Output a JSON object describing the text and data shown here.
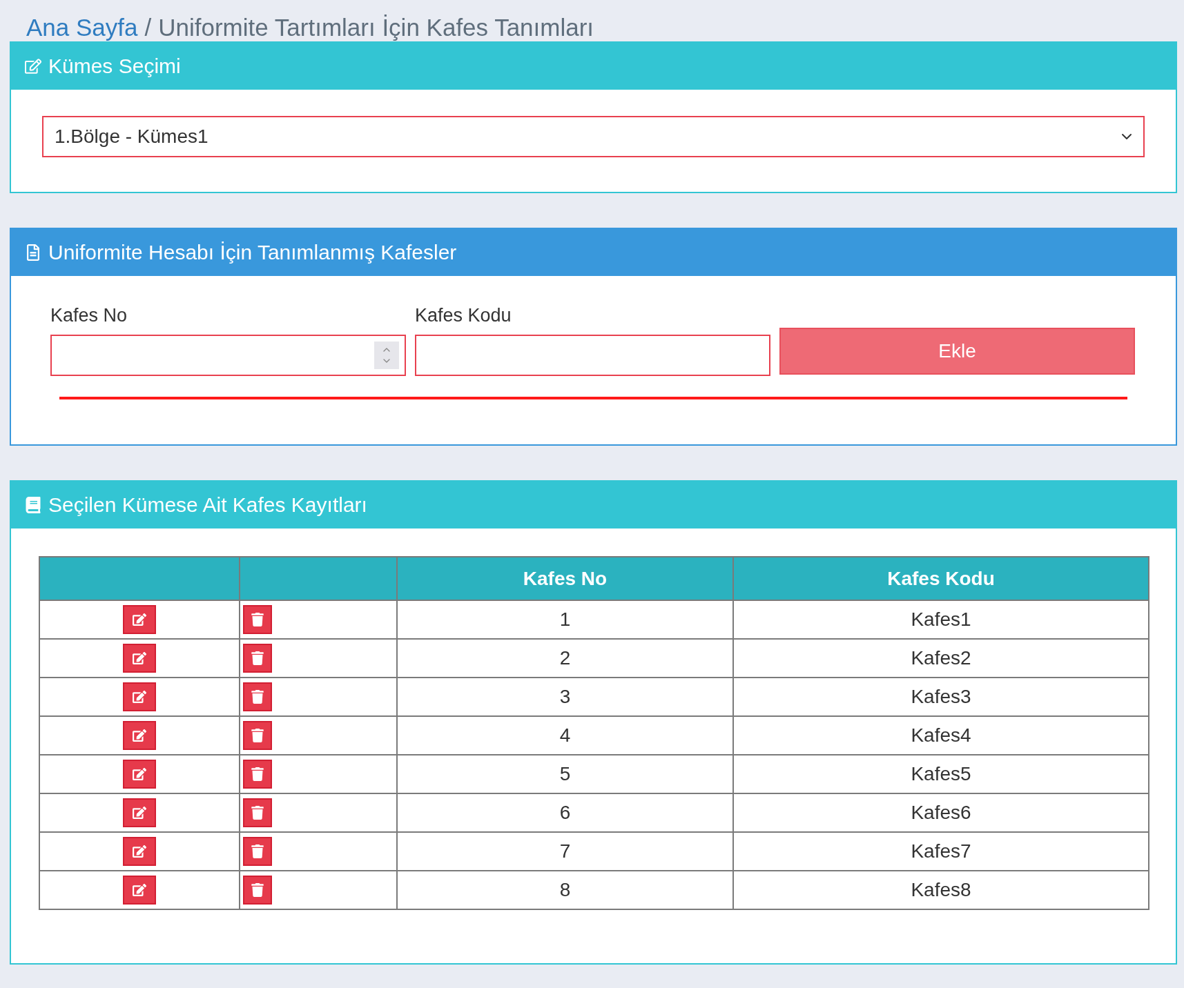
{
  "breadcrumb": {
    "home": "Ana Sayfa",
    "separator": "/",
    "current": "Uniformite Tartımları İçin Kafes Tanımları"
  },
  "coop_panel": {
    "title": "Kümes Seçimi",
    "select": {
      "value": "1.Bölge - Kümes1"
    }
  },
  "cage_form_panel": {
    "title": "Uniformite Hesabı İçin Tanımlanmış Kafesler",
    "fields": [
      {
        "label": "Kafes No",
        "kind": "number"
      },
      {
        "label": "Kafes Kodu",
        "kind": "text"
      }
    ],
    "add_button": "Ekle"
  },
  "records_panel": {
    "title": "Seçilen Kümese Ait Kafes Kayıtları",
    "table": {
      "columns": [
        "Kafes No",
        "Kafes Kodu"
      ],
      "rows": [
        {
          "no": "1",
          "code": "Kafes1"
        },
        {
          "no": "2",
          "code": "Kafes2"
        },
        {
          "no": "3",
          "code": "Kafes3"
        },
        {
          "no": "4",
          "code": "Kafes4"
        },
        {
          "no": "5",
          "code": "Kafes5"
        },
        {
          "no": "6",
          "code": "Kafes6"
        },
        {
          "no": "7",
          "code": "Kafes7"
        },
        {
          "no": "8",
          "code": "Kafes8"
        }
      ]
    }
  }
}
